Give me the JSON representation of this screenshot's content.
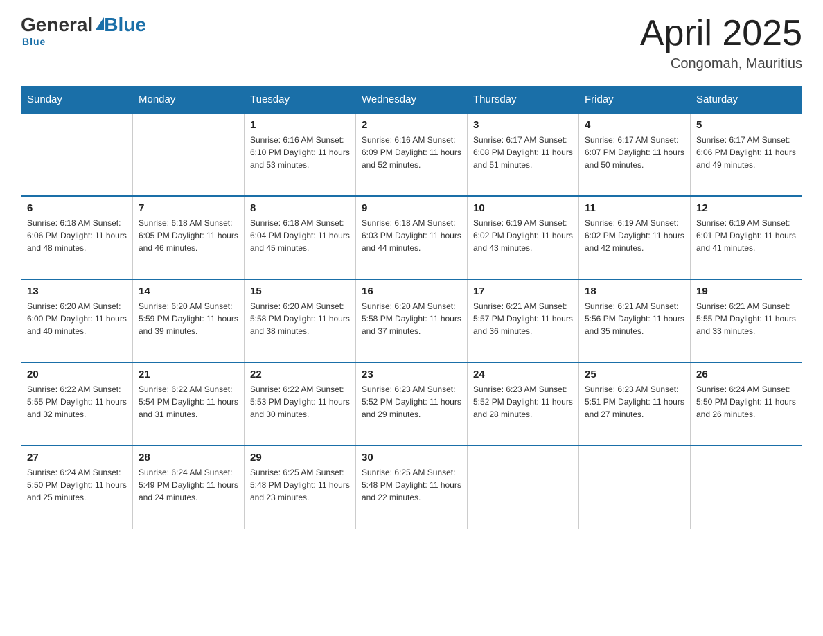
{
  "header": {
    "logo_general": "General",
    "logo_blue": "Blue",
    "calendar_title": "April 2025",
    "location": "Congomah, Mauritius"
  },
  "weekdays": [
    "Sunday",
    "Monday",
    "Tuesday",
    "Wednesday",
    "Thursday",
    "Friday",
    "Saturday"
  ],
  "weeks": [
    [
      {
        "day": "",
        "info": ""
      },
      {
        "day": "",
        "info": ""
      },
      {
        "day": "1",
        "info": "Sunrise: 6:16 AM\nSunset: 6:10 PM\nDaylight: 11 hours\nand 53 minutes."
      },
      {
        "day": "2",
        "info": "Sunrise: 6:16 AM\nSunset: 6:09 PM\nDaylight: 11 hours\nand 52 minutes."
      },
      {
        "day": "3",
        "info": "Sunrise: 6:17 AM\nSunset: 6:08 PM\nDaylight: 11 hours\nand 51 minutes."
      },
      {
        "day": "4",
        "info": "Sunrise: 6:17 AM\nSunset: 6:07 PM\nDaylight: 11 hours\nand 50 minutes."
      },
      {
        "day": "5",
        "info": "Sunrise: 6:17 AM\nSunset: 6:06 PM\nDaylight: 11 hours\nand 49 minutes."
      }
    ],
    [
      {
        "day": "6",
        "info": "Sunrise: 6:18 AM\nSunset: 6:06 PM\nDaylight: 11 hours\nand 48 minutes."
      },
      {
        "day": "7",
        "info": "Sunrise: 6:18 AM\nSunset: 6:05 PM\nDaylight: 11 hours\nand 46 minutes."
      },
      {
        "day": "8",
        "info": "Sunrise: 6:18 AM\nSunset: 6:04 PM\nDaylight: 11 hours\nand 45 minutes."
      },
      {
        "day": "9",
        "info": "Sunrise: 6:18 AM\nSunset: 6:03 PM\nDaylight: 11 hours\nand 44 minutes."
      },
      {
        "day": "10",
        "info": "Sunrise: 6:19 AM\nSunset: 6:02 PM\nDaylight: 11 hours\nand 43 minutes."
      },
      {
        "day": "11",
        "info": "Sunrise: 6:19 AM\nSunset: 6:02 PM\nDaylight: 11 hours\nand 42 minutes."
      },
      {
        "day": "12",
        "info": "Sunrise: 6:19 AM\nSunset: 6:01 PM\nDaylight: 11 hours\nand 41 minutes."
      }
    ],
    [
      {
        "day": "13",
        "info": "Sunrise: 6:20 AM\nSunset: 6:00 PM\nDaylight: 11 hours\nand 40 minutes."
      },
      {
        "day": "14",
        "info": "Sunrise: 6:20 AM\nSunset: 5:59 PM\nDaylight: 11 hours\nand 39 minutes."
      },
      {
        "day": "15",
        "info": "Sunrise: 6:20 AM\nSunset: 5:58 PM\nDaylight: 11 hours\nand 38 minutes."
      },
      {
        "day": "16",
        "info": "Sunrise: 6:20 AM\nSunset: 5:58 PM\nDaylight: 11 hours\nand 37 minutes."
      },
      {
        "day": "17",
        "info": "Sunrise: 6:21 AM\nSunset: 5:57 PM\nDaylight: 11 hours\nand 36 minutes."
      },
      {
        "day": "18",
        "info": "Sunrise: 6:21 AM\nSunset: 5:56 PM\nDaylight: 11 hours\nand 35 minutes."
      },
      {
        "day": "19",
        "info": "Sunrise: 6:21 AM\nSunset: 5:55 PM\nDaylight: 11 hours\nand 33 minutes."
      }
    ],
    [
      {
        "day": "20",
        "info": "Sunrise: 6:22 AM\nSunset: 5:55 PM\nDaylight: 11 hours\nand 32 minutes."
      },
      {
        "day": "21",
        "info": "Sunrise: 6:22 AM\nSunset: 5:54 PM\nDaylight: 11 hours\nand 31 minutes."
      },
      {
        "day": "22",
        "info": "Sunrise: 6:22 AM\nSunset: 5:53 PM\nDaylight: 11 hours\nand 30 minutes."
      },
      {
        "day": "23",
        "info": "Sunrise: 6:23 AM\nSunset: 5:52 PM\nDaylight: 11 hours\nand 29 minutes."
      },
      {
        "day": "24",
        "info": "Sunrise: 6:23 AM\nSunset: 5:52 PM\nDaylight: 11 hours\nand 28 minutes."
      },
      {
        "day": "25",
        "info": "Sunrise: 6:23 AM\nSunset: 5:51 PM\nDaylight: 11 hours\nand 27 minutes."
      },
      {
        "day": "26",
        "info": "Sunrise: 6:24 AM\nSunset: 5:50 PM\nDaylight: 11 hours\nand 26 minutes."
      }
    ],
    [
      {
        "day": "27",
        "info": "Sunrise: 6:24 AM\nSunset: 5:50 PM\nDaylight: 11 hours\nand 25 minutes."
      },
      {
        "day": "28",
        "info": "Sunrise: 6:24 AM\nSunset: 5:49 PM\nDaylight: 11 hours\nand 24 minutes."
      },
      {
        "day": "29",
        "info": "Sunrise: 6:25 AM\nSunset: 5:48 PM\nDaylight: 11 hours\nand 23 minutes."
      },
      {
        "day": "30",
        "info": "Sunrise: 6:25 AM\nSunset: 5:48 PM\nDaylight: 11 hours\nand 22 minutes."
      },
      {
        "day": "",
        "info": ""
      },
      {
        "day": "",
        "info": ""
      },
      {
        "day": "",
        "info": ""
      }
    ]
  ]
}
